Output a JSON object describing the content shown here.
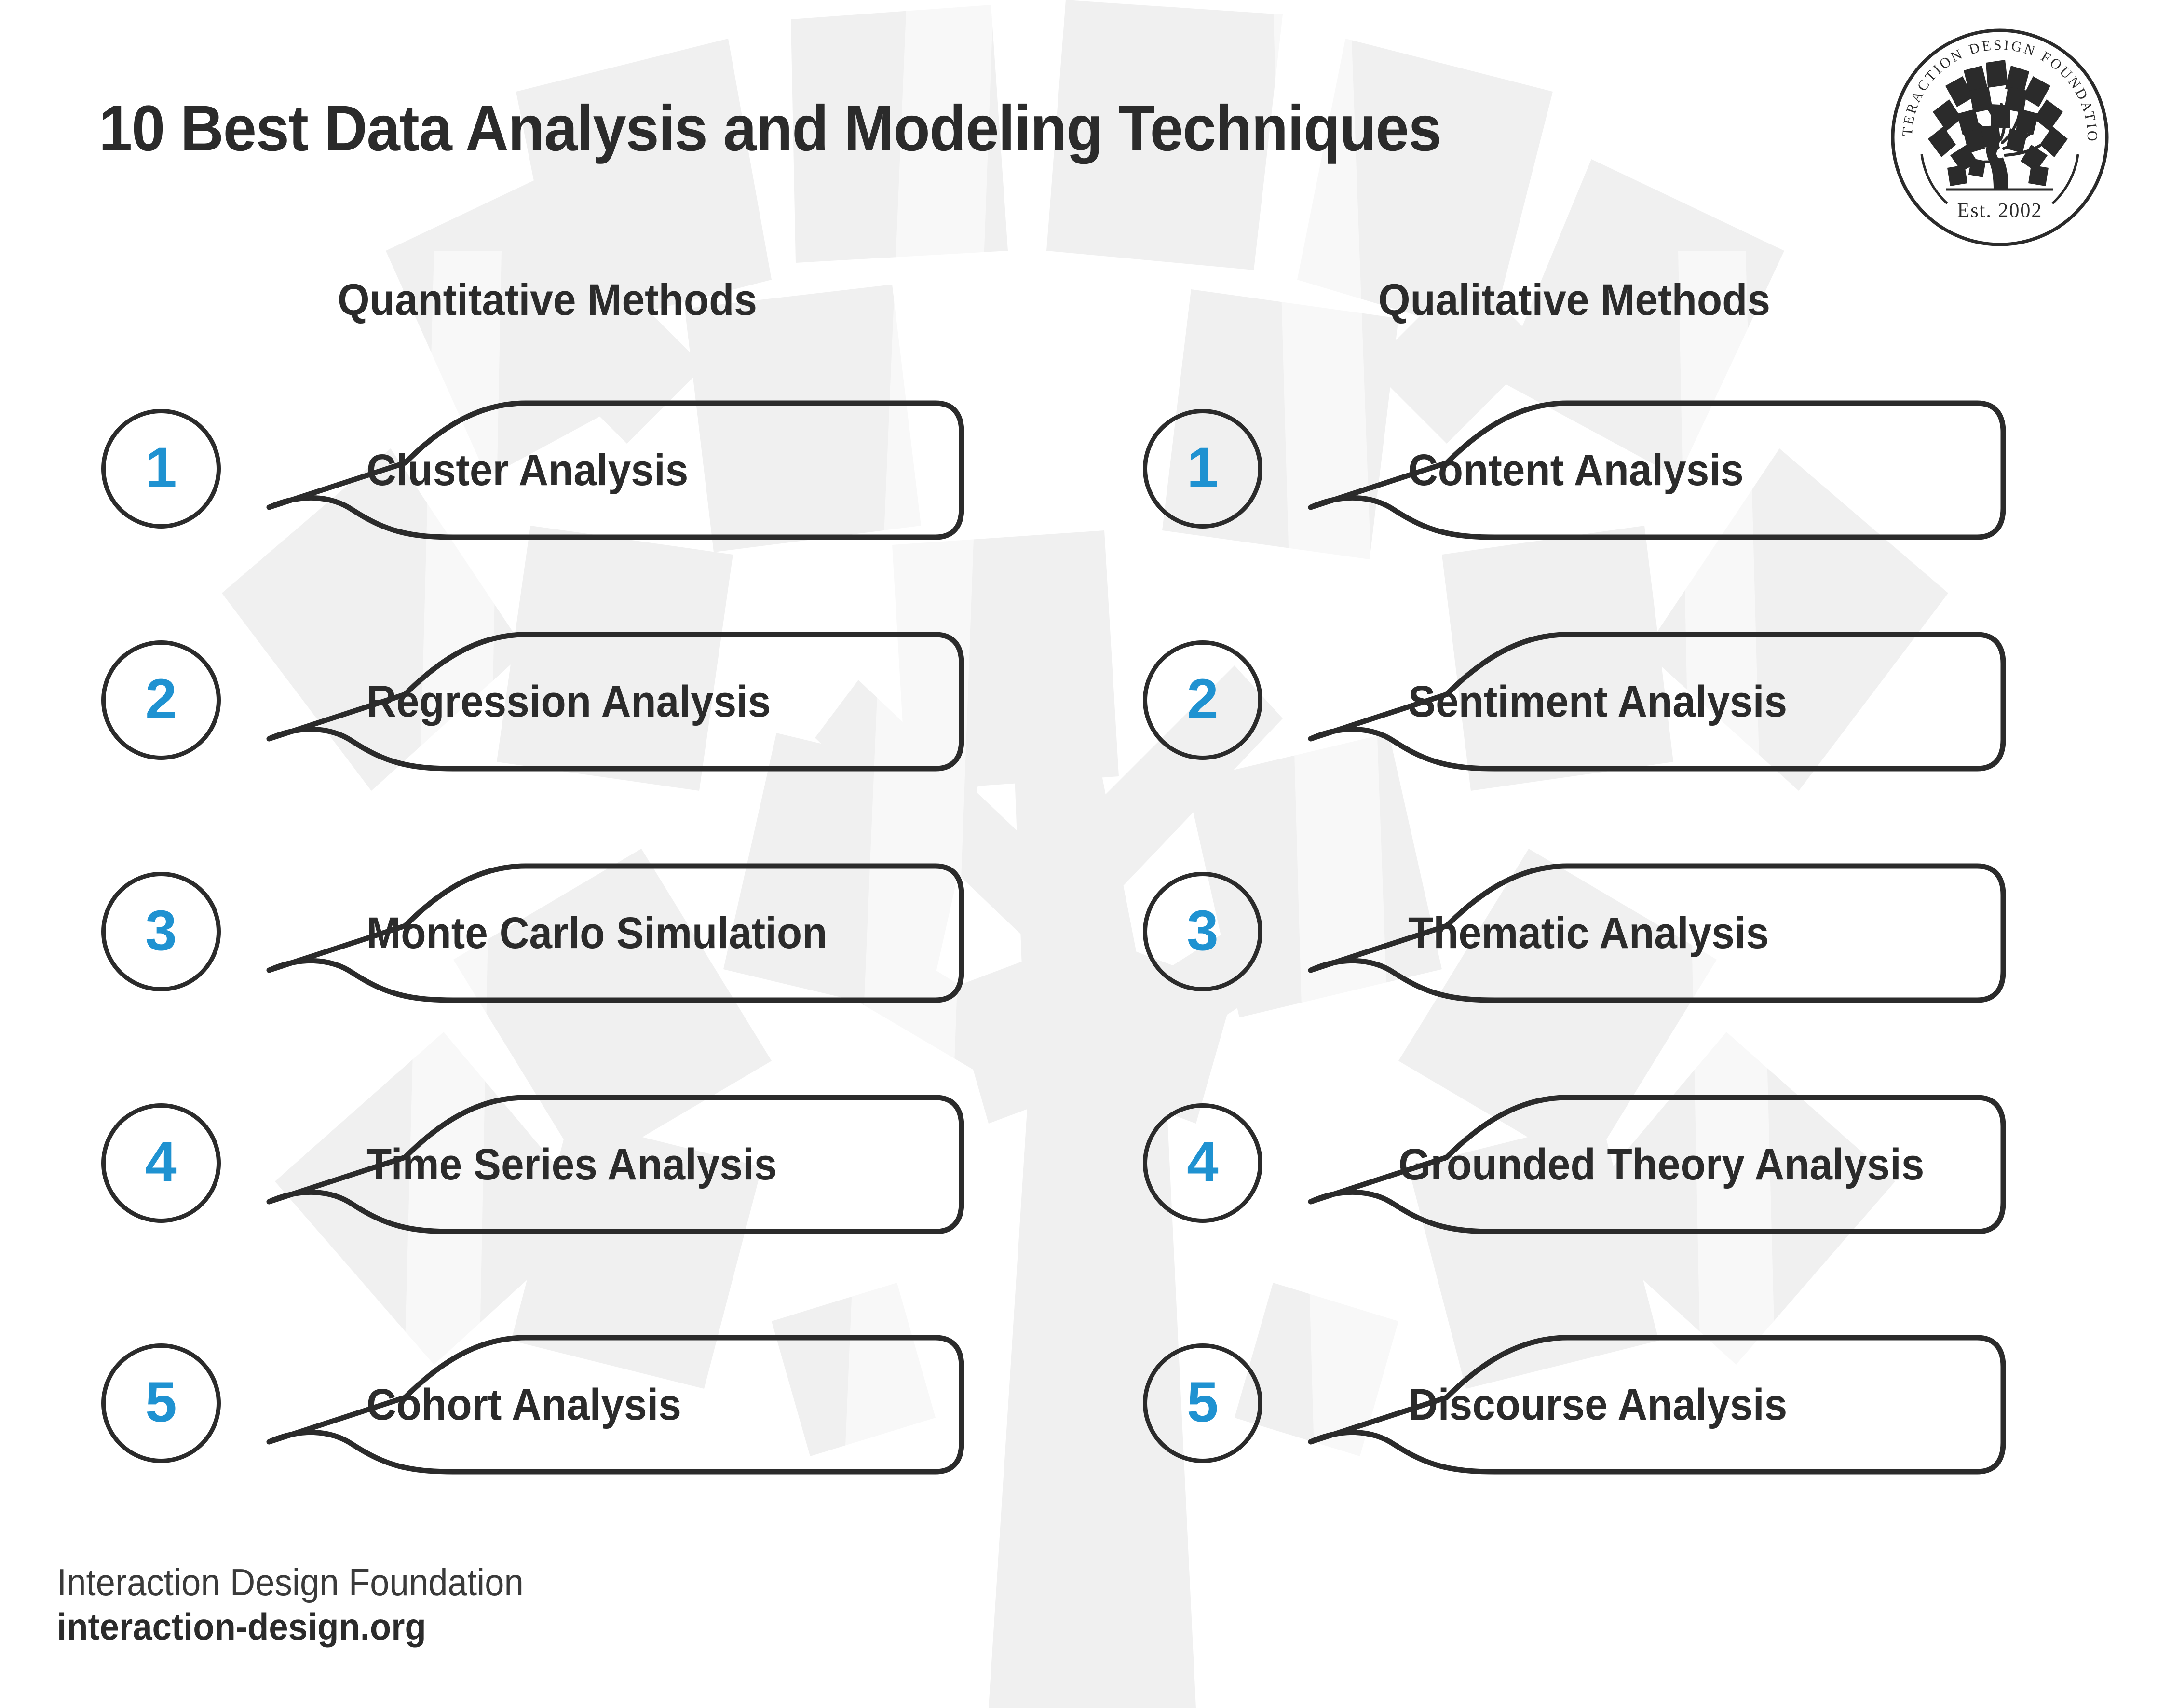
{
  "title": "10 Best Data Analysis and Modeling Techniques",
  "logo": {
    "ring_text": "INTERACTION DESIGN FOUNDATION",
    "established": "Est. 2002",
    "icon": "tree-logo-icon"
  },
  "columns": [
    {
      "header": "Quantitative Methods",
      "items": [
        {
          "number": "1",
          "label": "Cluster Analysis"
        },
        {
          "number": "2",
          "label": "Regression Analysis"
        },
        {
          "number": "3",
          "label": "Monte Carlo Simulation"
        },
        {
          "number": "4",
          "label": "Time Series Analysis"
        },
        {
          "number": "5",
          "label": "Cohort Analysis"
        }
      ]
    },
    {
      "header": "Qualitative Methods",
      "items": [
        {
          "number": "1",
          "label": "Content Analysis"
        },
        {
          "number": "2",
          "label": "Sentiment Analysis"
        },
        {
          "number": "3",
          "label": "Thematic Analysis"
        },
        {
          "number": "4",
          "label": "Grounded Theory Analysis"
        },
        {
          "number": "5",
          "label": "Discourse Analysis"
        }
      ]
    }
  ],
  "footer": {
    "organization": "Interaction Design Foundation",
    "url": "interaction-design.org"
  },
  "colors": {
    "accent_blue": "#1f92d1",
    "ink": "#2b2b2b",
    "background": "#ffffff",
    "watermark": "#f0f0f0"
  }
}
